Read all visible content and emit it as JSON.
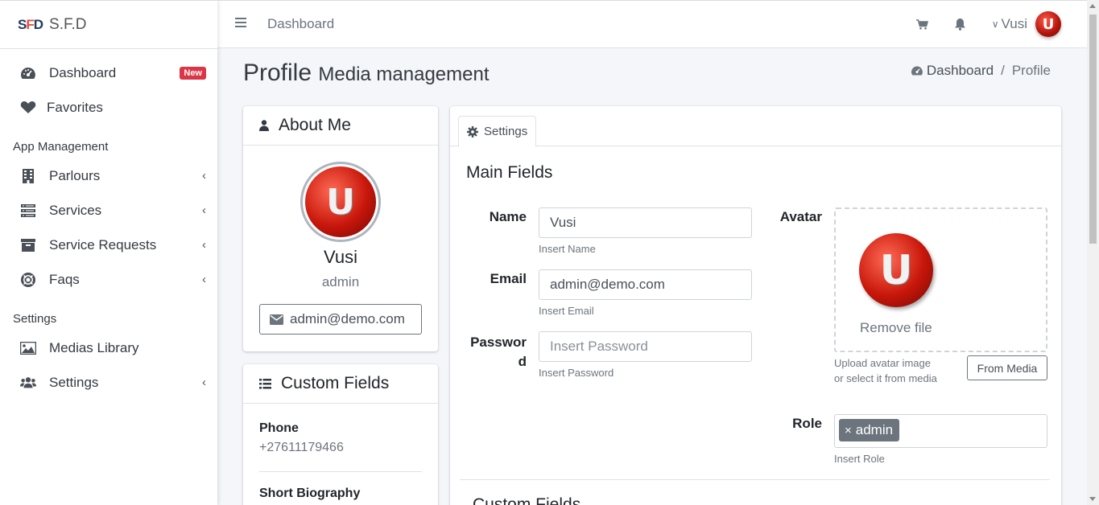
{
  "brand": {
    "logo_text": "SFD",
    "name": "S.F.D"
  },
  "sidebar": {
    "items": [
      {
        "label": "Dashboard",
        "icon": "dashboard-icon",
        "badge": "New"
      },
      {
        "label": "Favorites",
        "icon": "heart-icon"
      }
    ],
    "app_header": "App Management",
    "app_items": [
      {
        "label": "Parlours",
        "icon": "building-icon"
      },
      {
        "label": "Services",
        "icon": "list-icon"
      },
      {
        "label": "Service Requests",
        "icon": "archive-icon"
      },
      {
        "label": "Faqs",
        "icon": "life-ring-icon"
      }
    ],
    "settings_header": "Settings",
    "settings_items": [
      {
        "label": "Medias Library",
        "icon": "image-icon"
      },
      {
        "label": "Settings",
        "icon": "users-icon"
      }
    ]
  },
  "topbar": {
    "title": "Dashboard",
    "user_name": "Vusi"
  },
  "page": {
    "title": "Profile",
    "subtitle": "Media management"
  },
  "breadcrumb": {
    "home": "Dashboard",
    "current": "Profile"
  },
  "about": {
    "title": "About Me",
    "name": "Vusi",
    "role": "admin",
    "email": "admin@demo.com"
  },
  "custom_fields": {
    "title": "Custom Fields",
    "phone_label": "Phone",
    "phone_value": "+27611179466",
    "bio_label": "Short Biography"
  },
  "settings": {
    "tab_label": "Settings",
    "main_title": "Main Fields",
    "name_label": "Name",
    "name_value": "Vusi",
    "name_help": "Insert Name",
    "email_label": "Email",
    "email_value": "admin@demo.com",
    "email_help": "Insert Email",
    "password_label_1": "Passwor",
    "password_label_2": "d",
    "password_placeholder": "Insert Password",
    "password_help": "Insert Password",
    "avatar_label": "Avatar",
    "remove_file": "Remove file",
    "avatar_help": "Upload avatar image or select it from media",
    "from_media": "From Media",
    "role_label": "Role",
    "role_tag": "admin",
    "role_tag_remove": "×",
    "role_help": "Insert Role",
    "custom_title": "Custom Fields"
  },
  "avatar_letter": "U",
  "colors": {
    "badge": "#dc3545",
    "avatar_red": "#c8160b",
    "tag_gray": "#6c757d"
  }
}
